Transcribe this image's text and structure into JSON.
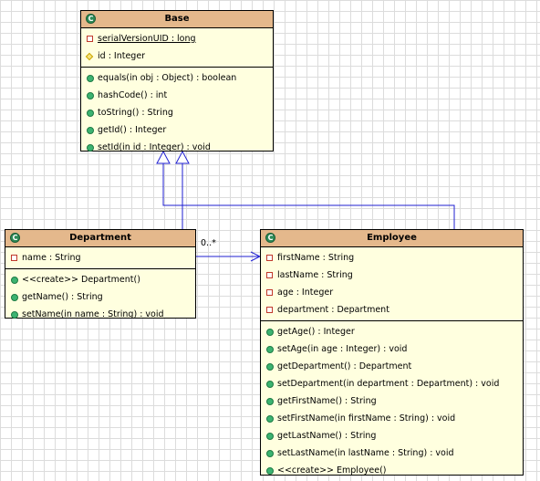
{
  "base": {
    "name": "Base",
    "attributes": [
      {
        "text": "serialVersionUID : long",
        "visibility": "private",
        "static": true
      },
      {
        "text": "id : Integer",
        "visibility": "protected",
        "static": false
      }
    ],
    "operations": [
      {
        "text": "equals(in obj : Object) : boolean",
        "visibility": "public"
      },
      {
        "text": "hashCode() : int",
        "visibility": "public"
      },
      {
        "text": "toString() : String",
        "visibility": "public"
      },
      {
        "text": "getId() : Integer",
        "visibility": "public"
      },
      {
        "text": "setId(in id : Integer) : void",
        "visibility": "public"
      }
    ]
  },
  "department": {
    "name": "Department",
    "attributes": [
      {
        "text": "name : String",
        "visibility": "private"
      }
    ],
    "operations": [
      {
        "text": "<<create>> Department()",
        "visibility": "public"
      },
      {
        "text": "getName() : String",
        "visibility": "public"
      },
      {
        "text": "setName(in name : String) : void",
        "visibility": "public"
      }
    ]
  },
  "employee": {
    "name": "Employee",
    "attributes": [
      {
        "text": "firstName : String",
        "visibility": "private"
      },
      {
        "text": "lastName : String",
        "visibility": "private"
      },
      {
        "text": "age : Integer",
        "visibility": "private"
      },
      {
        "text": "department : Department",
        "visibility": "private"
      }
    ],
    "operations": [
      {
        "text": "getAge() : Integer",
        "visibility": "public"
      },
      {
        "text": "setAge(in age : Integer) : void",
        "visibility": "public"
      },
      {
        "text": "getDepartment() : Department",
        "visibility": "public"
      },
      {
        "text": "setDepartment(in department : Department) : void",
        "visibility": "public"
      },
      {
        "text": "getFirstName() : String",
        "visibility": "public"
      },
      {
        "text": "setFirstName(in firstName : String) : void",
        "visibility": "public"
      },
      {
        "text": "getLastName() : String",
        "visibility": "public"
      },
      {
        "text": "setLastName(in lastName : String) : void",
        "visibility": "public"
      },
      {
        "text": "<<create>> Employee()",
        "visibility": "public"
      }
    ]
  },
  "association": {
    "multiplicity": "0..*"
  },
  "class_icon_letter": "C",
  "colors": {
    "header": "#e4b88c",
    "body": "#ffffdf",
    "link": "#1f1fd1"
  }
}
